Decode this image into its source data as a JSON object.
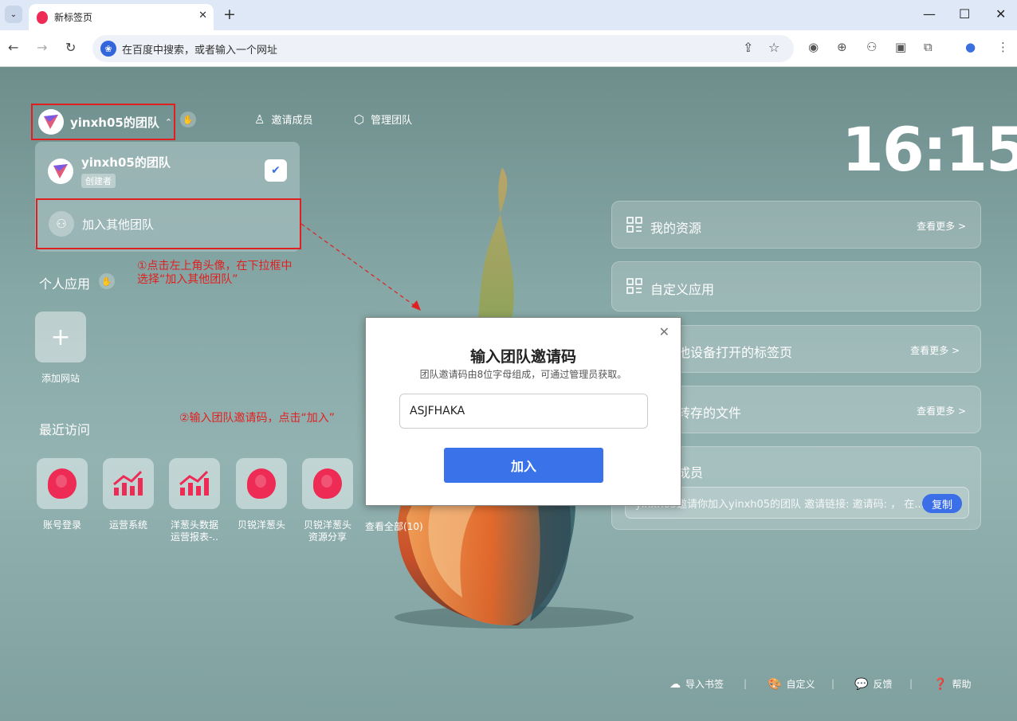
{
  "browser": {
    "tab_title": "新标签页",
    "new_tab_symbol": "+",
    "close_symbol": "✕",
    "tab_dropdown_symbol": "⌄",
    "window_minimize": "—",
    "window_maximize": "☐",
    "window_close": "✕",
    "omnibox_placeholder": "在百度中搜索，或者输入一个网址",
    "search_engine_icon": "baidu-icon"
  },
  "header": {
    "team_name": "yinxh05的团队",
    "invite_label": "邀请成员",
    "manage_label": "管理团队",
    "clock": "16:15"
  },
  "dropdown": {
    "team_name": "yinxh05的团队",
    "role_badge": "创建者",
    "join_other_label": "加入其他团队"
  },
  "annotations": {
    "step1_line1": "①点击左上角头像，在下拉框中",
    "step1_line2": "选择“加入其他团队”",
    "step2": "②输入团队邀请码，点击“加入”"
  },
  "personal_apps": {
    "title": "个人应用",
    "add_site_label": "添加网站"
  },
  "recent": {
    "title": "最近访问",
    "items": [
      {
        "label1": "账号登录",
        "label2": "",
        "icon": "logo"
      },
      {
        "label1": "运营系统",
        "label2": "",
        "icon": "chart"
      },
      {
        "label1": "洋葱头数据",
        "label2": "运营报表-..",
        "icon": "chart"
      },
      {
        "label1": "贝锐洋葱头",
        "label2": "",
        "icon": "logo"
      },
      {
        "label1": "贝锐洋葱头",
        "label2": "资源分享",
        "icon": "logo"
      }
    ],
    "view_all": "查看全部(10)"
  },
  "panels": {
    "resources_title": "我的资源",
    "resources_more": "查看更多 >",
    "custom_apps_title": "自定义应用",
    "other_devices_title": "他设备打开的标签页",
    "other_devices_more": "查看更多 >",
    "saved_files_title": "转存的文件",
    "saved_files_more": "查看更多 >",
    "members_title": "成员",
    "invite_text": "yinxh05邀请你加入yinxh05的团队 邀请链接: 邀请码: ， 在...",
    "copy_label": "复制"
  },
  "modal": {
    "title": "输入团队邀请码",
    "subtitle": "团队邀请码由8位字母组成，可通过管理员获取。",
    "input_value": "ASJFHAKA",
    "join_button": "加入",
    "close_symbol": "✕"
  },
  "footer": {
    "import_bookmarks": "导入书签",
    "customize": "自定义",
    "feedback": "反馈",
    "help": "帮助"
  },
  "colors": {
    "accent": "#3a72ea",
    "annotation_red": "#e02020",
    "logo_red": "#ee2b54"
  }
}
